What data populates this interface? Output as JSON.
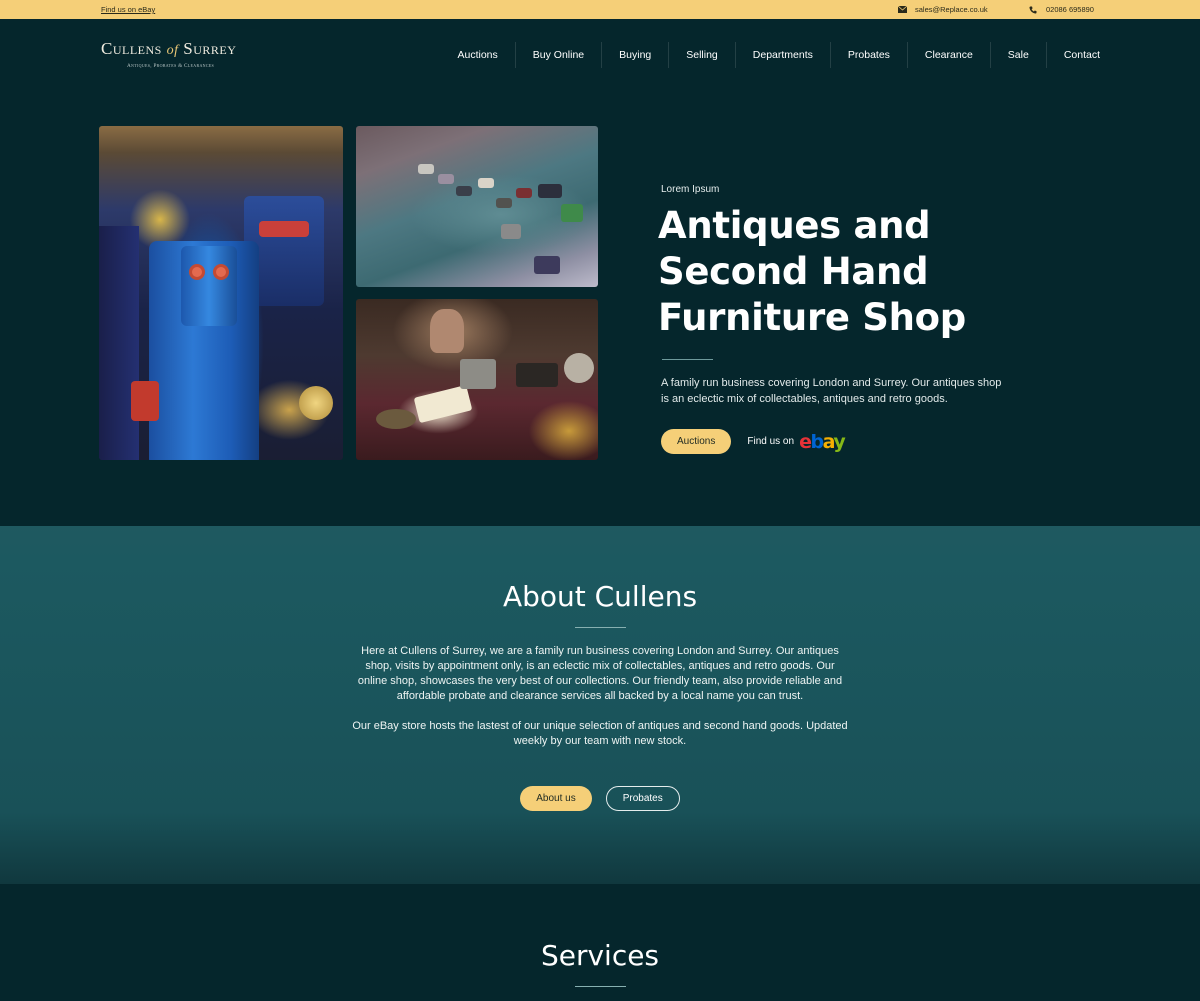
{
  "topbar": {
    "ebay_link": "Find us on eBay",
    "email": "sales@Replace.co.uk",
    "phone": "02086 695890"
  },
  "logo": {
    "name_part1": "Cullens",
    "name_of": "of",
    "name_part2": "Surrey",
    "tagline": "Antiques, Probates & Clearances"
  },
  "nav": {
    "items": [
      "Auctions",
      "Buy Online",
      "Buying",
      "Selling",
      "Departments",
      "Probates",
      "Clearance",
      "Sale",
      "Contact"
    ]
  },
  "hero": {
    "eyebrow": "Lorem Ipsum",
    "title": "Antiques and Second Hand Furniture Shop",
    "text": "A family run business covering London and Surrey. Our antiques shop is an eclectic mix of collectables, antiques and retro goods.",
    "primary_button": "Auctions",
    "find_us": "Find us on",
    "ebay_letters": [
      "e",
      "b",
      "a",
      "y"
    ]
  },
  "about": {
    "heading": "About Cullens",
    "paragraph1": "Here at Cullens of Surrey, we are a family run business covering London and Surrey. Our antiques shop, visits by appointment only, is an eclectic mix of collectables, antiques and retro goods. Our online shop, showcases the very best of our collections. Our friendly team, also provide reliable and affordable probate and clearance services all backed by a local name you can trust.",
    "paragraph2": "Our eBay store hosts the lastest of our unique selection of antiques and second hand goods. Updated weekly by our team with new stock.",
    "primary_button": "About us",
    "secondary_button": "Probates"
  },
  "services": {
    "heading": "Services"
  },
  "colors": {
    "accent": "#f5cf78",
    "dark_bg": "#05262c",
    "teal_bg": "#1c5960",
    "ebay_e": "#e53238",
    "ebay_b": "#0064d2",
    "ebay_a": "#f5af02",
    "ebay_y": "#86b817"
  }
}
